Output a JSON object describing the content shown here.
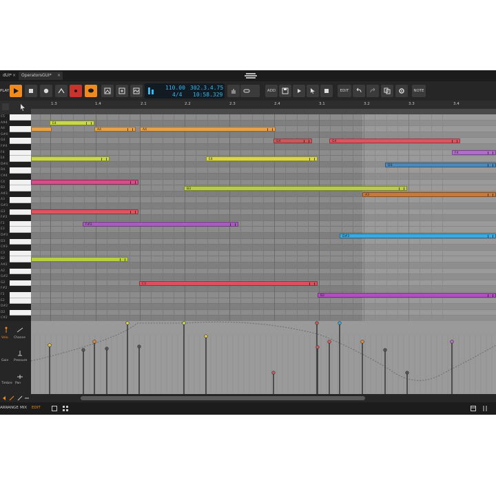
{
  "tabs": [
    {
      "label": "dUI*",
      "close": "×"
    },
    {
      "label": "OperatorsGUI*",
      "close": "×"
    }
  ],
  "toolbar": {
    "play_label": "PLAY",
    "tempo": "110.00",
    "position": "302.3.4.75",
    "signature": "4/4",
    "time": "10:58.329",
    "add_label": "ADD",
    "edit_label": "EDIT",
    "note_label": "NOTE",
    "accent_orange": "#f08a1e",
    "accent_red": "#c8342d",
    "display_blue": "#37b8f0"
  },
  "ruler": {
    "labels": [
      "1.3",
      "1.4",
      "2.1",
      "2.2",
      "2.3",
      "2.4",
      "3.1",
      "3.2",
      "3.3",
      "3.4"
    ]
  },
  "keys": [
    "C5",
    "A#4",
    "A4",
    "G#4",
    "G4",
    "F#4",
    "F4",
    "E4",
    "D#4",
    "D4",
    "C#4",
    "C4",
    "B3",
    "A#3",
    "A3",
    "G#3",
    "G3",
    "F#3",
    "F3",
    "E3",
    "D#3",
    "D3",
    "C#3",
    "C3",
    "B2",
    "A#2",
    "A2",
    "G#2",
    "G2",
    "F#2",
    "F2",
    "E2",
    "D#2",
    "D2",
    "C#2"
  ],
  "notes": [
    {
      "label": "E4",
      "color": "#c9d84a"
    },
    {
      "label": "",
      "color": "#e3a14a"
    },
    {
      "label": "A4",
      "color": "#e3a14a"
    },
    {
      "label": "A4",
      "color": "#e3a14a"
    },
    {
      "label": "G4",
      "color": "#c9595c"
    },
    {
      "label": "G4",
      "color": "#e05462"
    },
    {
      "label": "F4",
      "color": "#b56ad0"
    },
    {
      "label": "",
      "color": "#c9d84a"
    },
    {
      "label": "E4",
      "color": "#d9d64a"
    },
    {
      "label": "D4",
      "color": "#4e88b8"
    },
    {
      "label": "",
      "color": "#d94c8a"
    },
    {
      "label": "B3",
      "color": "#b8cc4a"
    },
    {
      "label": "A3",
      "color": "#c87a3a"
    },
    {
      "label": "",
      "color": "#e05462"
    },
    {
      "label": "F#3",
      "color": "#a85cc0"
    },
    {
      "label": "D#3",
      "color": "#3ba8e0"
    },
    {
      "label": "",
      "color": "#b8d040"
    },
    {
      "label": "C3",
      "color": "#d9505e"
    },
    {
      "label": "B2",
      "color": "#b050c0"
    }
  ],
  "expressions": {
    "labels": [
      "Velo.",
      "Chance",
      "Gain",
      "Pressure",
      "Timbre",
      "Pan"
    ]
  },
  "bottom": {
    "arrange": "ARRANGE",
    "mix": "MIX",
    "edit": "EDIT"
  }
}
